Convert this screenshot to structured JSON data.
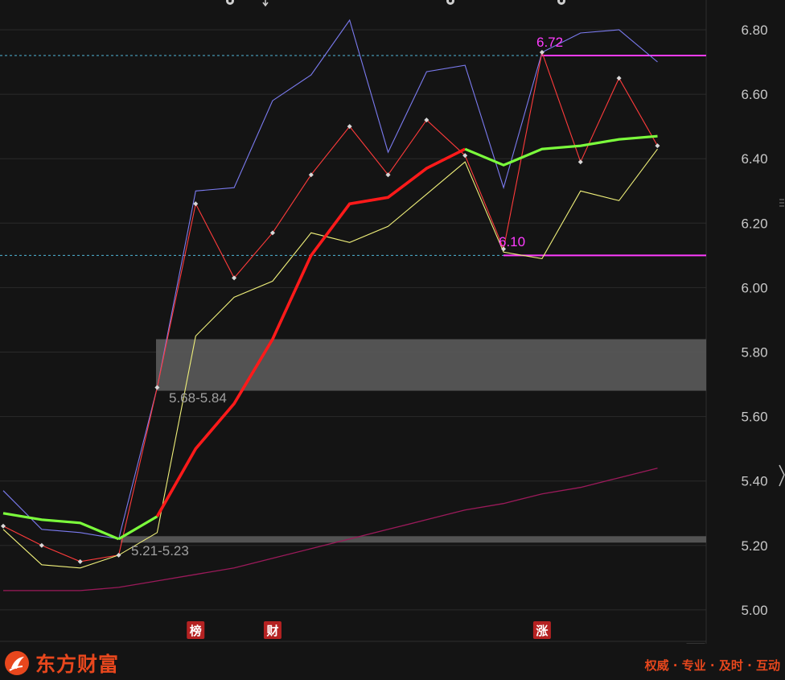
{
  "colors": {
    "background": "#141414",
    "grid": "#2a2a2a",
    "axis_text": "#c8c8c8",
    "dashed_ref": "#4fb6d8",
    "level_line": "#ff3cff",
    "level_label": "#ff3cff",
    "band": "#5a5a5a",
    "band_label": "#a0a0a0",
    "ma_slow": "#9b1a5a",
    "upper": "#7b7bf0",
    "mid": "#ff3b3b",
    "lower": "#f0f07a",
    "cost_up": "#ff1a1a",
    "cost_down": "#7cff3c",
    "marker_bg": "#b52222",
    "brand": "#e8471d"
  },
  "chart_data": {
    "type": "line",
    "ylim": [
      4.9,
      6.9
    ],
    "yticks": [
      "6.80",
      "6.60",
      "6.40",
      "6.20",
      "6.00",
      "5.80",
      "5.60",
      "5.40",
      "5.20",
      "5.00"
    ],
    "x": [
      0,
      1,
      2,
      3,
      4,
      5,
      6,
      7,
      8,
      9,
      10,
      11,
      12,
      13,
      14,
      15,
      16,
      17,
      18
    ],
    "series": [
      {
        "role": "upper",
        "values": [
          5.37,
          5.25,
          5.24,
          5.22,
          5.69,
          6.3,
          6.31,
          6.58,
          6.66,
          6.83,
          6.42,
          6.67,
          6.69,
          6.31,
          6.73,
          6.79,
          6.8,
          6.7,
          null
        ]
      },
      {
        "role": "mid",
        "values": [
          5.26,
          5.2,
          5.15,
          5.17,
          5.69,
          6.26,
          6.03,
          6.17,
          6.35,
          6.5,
          6.35,
          6.52,
          6.41,
          6.12,
          6.73,
          6.39,
          6.65,
          6.44,
          null
        ]
      },
      {
        "role": "lower",
        "values": [
          5.25,
          5.14,
          5.13,
          5.17,
          5.24,
          5.85,
          5.97,
          6.02,
          6.17,
          6.14,
          6.19,
          6.29,
          6.39,
          6.11,
          6.09,
          6.3,
          6.27,
          6.43,
          null
        ]
      },
      {
        "role": "ma_slow",
        "values": [
          5.06,
          5.06,
          5.06,
          5.07,
          5.09,
          5.11,
          5.13,
          5.16,
          5.19,
          5.22,
          5.25,
          5.28,
          5.31,
          5.33,
          5.36,
          5.38,
          5.41,
          5.44,
          null
        ]
      },
      {
        "role": "cost",
        "values": [
          5.3,
          5.28,
          5.27,
          5.22,
          5.29,
          5.5,
          5.64,
          5.84,
          6.1,
          6.26,
          6.28,
          6.37,
          6.43,
          6.38,
          6.43,
          6.44,
          6.46,
          6.47,
          null
        ]
      }
    ],
    "bands": [
      {
        "range": [
          5.68,
          5.84
        ],
        "label": "5.68-5.84"
      },
      {
        "range": [
          5.21,
          5.23
        ],
        "label": "5.21-5.23"
      }
    ],
    "levels": [
      {
        "value": 6.72,
        "label": "6.72"
      },
      {
        "value": 6.1,
        "label": "6.10"
      }
    ],
    "markers": [
      {
        "x": 5,
        "label": "榜"
      },
      {
        "x": 7,
        "label": "财"
      },
      {
        "x": 14,
        "label": "涨"
      }
    ]
  },
  "footer": {
    "brand_name": "东方财富",
    "slogan": "权威 · 专业 · 及时 · 互动"
  }
}
